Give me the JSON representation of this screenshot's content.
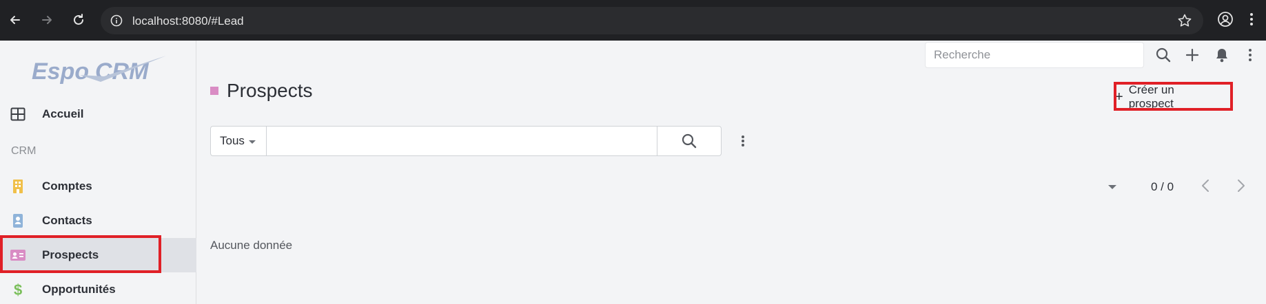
{
  "browser": {
    "url": "localhost:8080/#Lead"
  },
  "sidebar": {
    "logo": "EspoCRM",
    "items": [
      {
        "label": "Accueil",
        "icon": "home-grid-icon"
      },
      {
        "label": "Comptes",
        "icon": "building-icon",
        "color": "#f0c04a"
      },
      {
        "label": "Contacts",
        "icon": "contact-badge-icon",
        "color": "#8fb3d9"
      },
      {
        "label": "Prospects",
        "icon": "id-card-icon",
        "color": "#d98cc4"
      },
      {
        "label": "Opportunités",
        "icon": "dollar-icon",
        "color": "#7bbf5c"
      }
    ],
    "section_crm": "CRM"
  },
  "header": {
    "search_placeholder": "Recherche"
  },
  "main": {
    "title": "Prospects",
    "title_color": "#d98cc4",
    "create_label": "Créer un prospect",
    "filter_label": "Tous",
    "pager": "0 / 0",
    "empty_text": "Aucune donnée"
  }
}
